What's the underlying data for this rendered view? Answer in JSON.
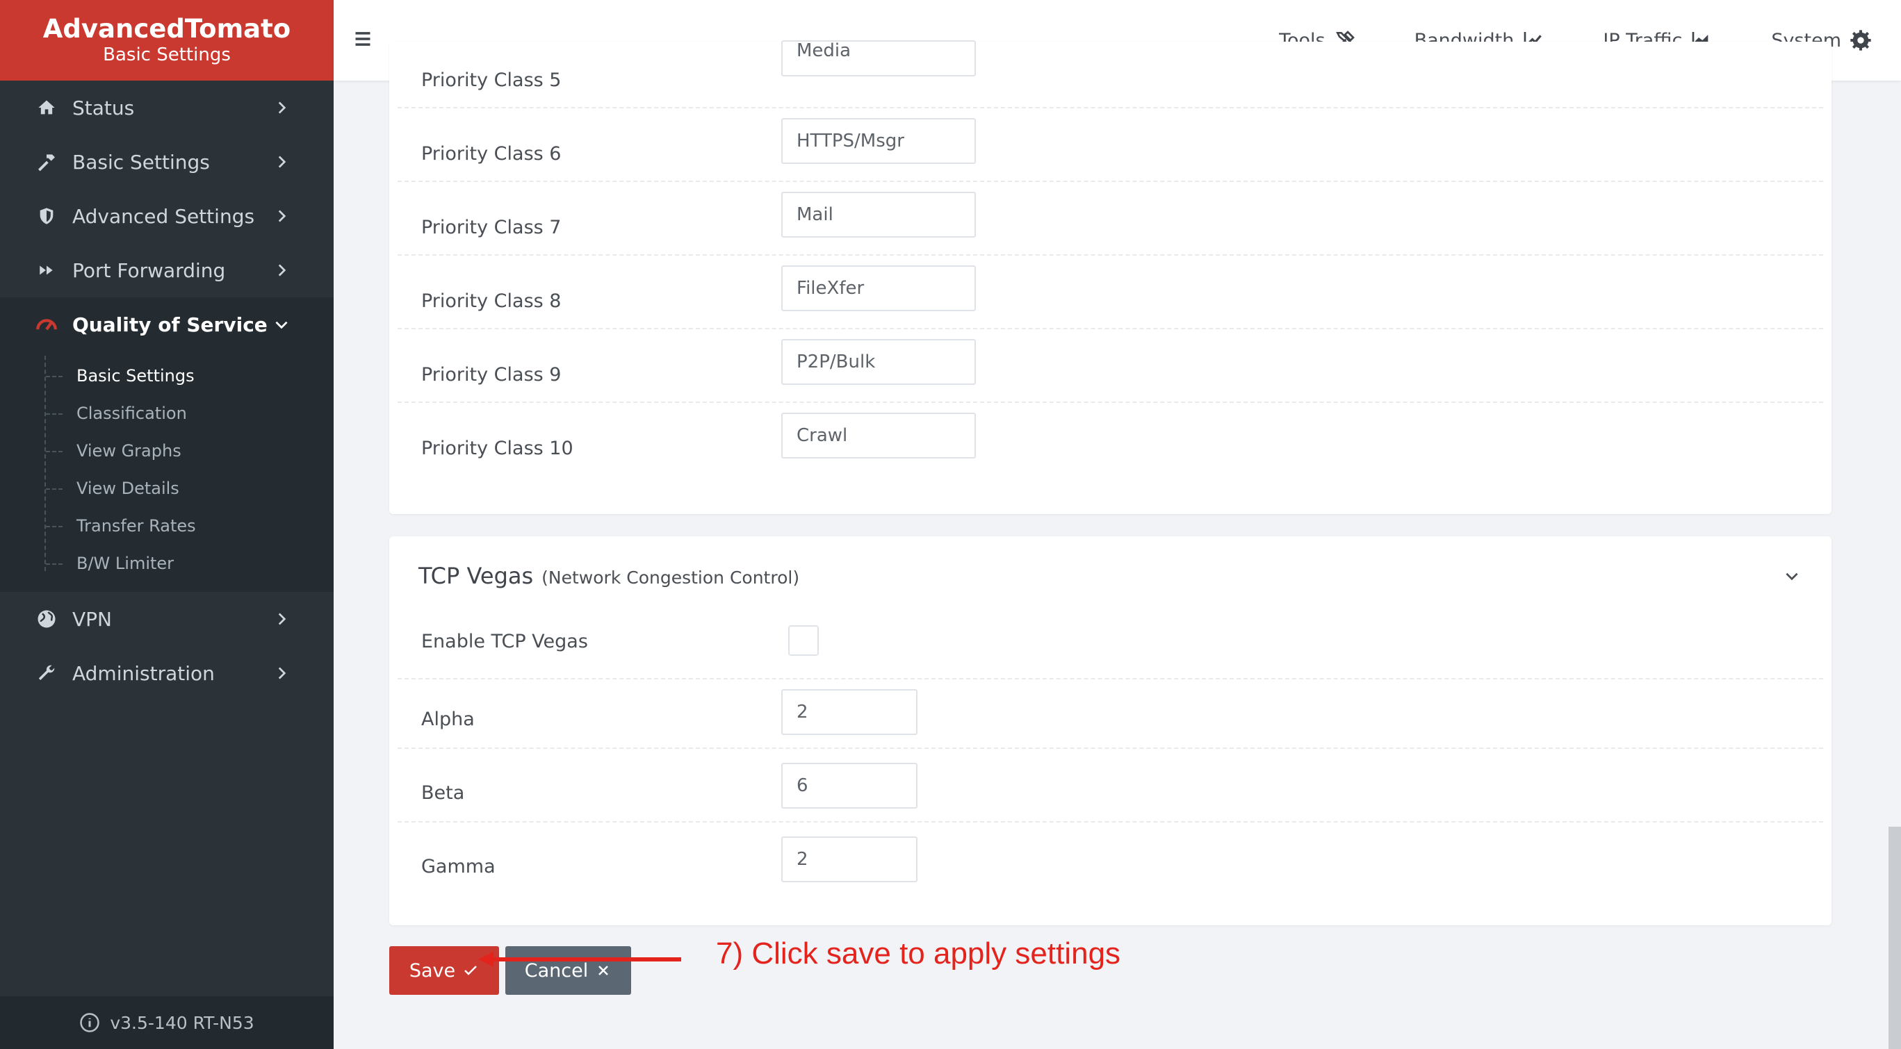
{
  "brand": {
    "title": "AdvancedTomato",
    "subtitle": "Basic Settings"
  },
  "sidebar": {
    "items": [
      {
        "label": "Status",
        "icon": "home-icon"
      },
      {
        "label": "Basic Settings",
        "icon": "hammer-icon"
      },
      {
        "label": "Advanced Settings",
        "icon": "shield-icon"
      },
      {
        "label": "Port Forwarding",
        "icon": "fast-forward-icon"
      },
      {
        "label": "Quality of Service",
        "icon": "gauge-icon"
      },
      {
        "label": "VPN",
        "icon": "globe-icon"
      },
      {
        "label": "Administration",
        "icon": "wrench-icon"
      }
    ],
    "qos_subitems": [
      "Basic Settings",
      "Classification",
      "View Graphs",
      "View Details",
      "Transfer Rates",
      "B/W Limiter"
    ],
    "version": "v3.5-140 RT-N53"
  },
  "topbar": {
    "links": [
      {
        "label": "Tools",
        "icon": "tools-icon"
      },
      {
        "label": "Bandwidth",
        "icon": "line-chart-icon"
      },
      {
        "label": "IP Traffic",
        "icon": "area-chart-icon"
      },
      {
        "label": "System",
        "icon": "gear-icon"
      }
    ]
  },
  "priority_classes": [
    {
      "label": "Priority Class 5",
      "value": "Media"
    },
    {
      "label": "Priority Class 6",
      "value": "HTTPS/Msgr"
    },
    {
      "label": "Priority Class 7",
      "value": "Mail"
    },
    {
      "label": "Priority Class 8",
      "value": "FileXfer"
    },
    {
      "label": "Priority Class 9",
      "value": "P2P/Bulk"
    },
    {
      "label": "Priority Class 10",
      "value": "Crawl"
    }
  ],
  "tcp_vegas": {
    "title": "TCP Vegas",
    "subtitle": "(Network Congestion Control)",
    "enable_label": "Enable TCP Vegas",
    "enabled": false,
    "alpha_label": "Alpha",
    "alpha": "2",
    "beta_label": "Beta",
    "beta": "6",
    "gamma_label": "Gamma",
    "gamma": "2"
  },
  "buttons": {
    "save": "Save",
    "cancel": "Cancel"
  },
  "annotation": "7) Click save to apply settings",
  "colors": {
    "brand": "#c9392f",
    "sidebar": "#2b3339",
    "annotation": "#e3231c",
    "cancel": "#5b6873"
  }
}
